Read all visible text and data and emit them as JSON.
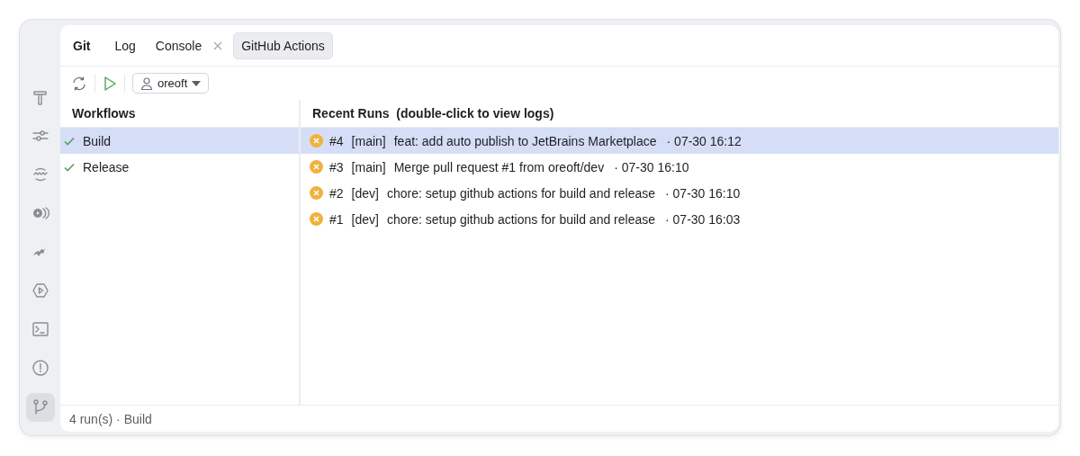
{
  "tool_rail": [
    {
      "selected": false
    },
    {
      "selected": false
    },
    {
      "selected": false
    },
    {
      "selected": false
    },
    {
      "selected": false
    },
    {
      "selected": false
    },
    {
      "selected": false
    },
    {
      "selected": false
    },
    {
      "selected": true
    }
  ],
  "tool_window": {
    "title": "Git",
    "tabs": [
      {
        "label": "Log",
        "selected": false,
        "closable": false
      },
      {
        "label": "Console",
        "selected": false,
        "closable": true
      },
      {
        "label": "GitHub Actions",
        "selected": true,
        "closable": false
      }
    ]
  },
  "toolbar": {
    "user_dropdown": "oreoft"
  },
  "workflows": {
    "heading": "Workflows",
    "items": [
      {
        "name": "Build",
        "passed": true,
        "selected": true
      },
      {
        "name": "Release",
        "passed": true,
        "selected": false
      }
    ]
  },
  "runs": {
    "heading": "Recent Runs  (double-click to view logs)",
    "items": [
      {
        "failed": true,
        "number": "#4",
        "branch": "[main]",
        "message": "feat: add auto publish to JetBrains Marketplace",
        "time": "· 07-30 16:12",
        "selected": true
      },
      {
        "failed": true,
        "number": "#3",
        "branch": "[main]",
        "message": "Merge pull request #1 from oreoft/dev",
        "time": "· 07-30 16:10",
        "selected": false
      },
      {
        "failed": true,
        "number": "#2",
        "branch": "[dev]",
        "message": "chore: setup github actions for build and release",
        "time": "· 07-30 16:10",
        "selected": false
      },
      {
        "failed": true,
        "number": "#1",
        "branch": "[dev]",
        "message": "chore: setup github actions for build and release",
        "time": "· 07-30 16:03",
        "selected": false
      }
    ]
  },
  "status_bar": "4 run(s) · Build"
}
